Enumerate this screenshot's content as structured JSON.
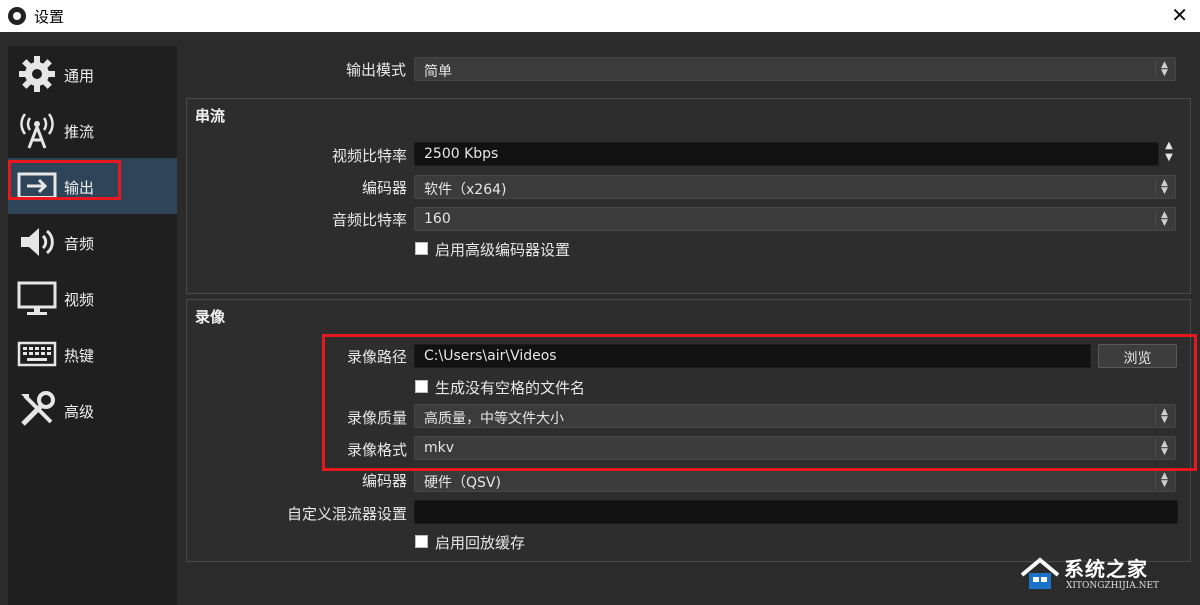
{
  "window": {
    "title": "设置",
    "close_glyph": "✕"
  },
  "sidebar": {
    "items": [
      {
        "label": "通用",
        "icon": "gear-icon"
      },
      {
        "label": "推流",
        "icon": "broadcast-antenna-icon"
      },
      {
        "label": "输出",
        "icon": "output-icon",
        "active": true
      },
      {
        "label": "音频",
        "icon": "speaker-icon"
      },
      {
        "label": "视频",
        "icon": "monitor-icon"
      },
      {
        "label": "热键",
        "icon": "keyboard-icon"
      },
      {
        "label": "高级",
        "icon": "tools-icon"
      }
    ]
  },
  "output_mode": {
    "label": "输出模式",
    "value": "简单"
  },
  "streaming": {
    "title": "串流",
    "video_bitrate": {
      "label": "视频比特率",
      "value": "2500 Kbps"
    },
    "encoder": {
      "label": "编码器",
      "value": "软件（x264)"
    },
    "audio_bitrate": {
      "label": "音频比特率",
      "value": "160"
    },
    "advanced_encoder": {
      "label": "启用高级编码器设置",
      "checked": false
    }
  },
  "recording": {
    "title": "录像",
    "path": {
      "label": "录像路径",
      "value": "C:\\Users\\air\\Videos",
      "browse_label": "浏览"
    },
    "no_space_filename": {
      "label": "生成没有空格的文件名",
      "checked": false
    },
    "quality": {
      "label": "录像质量",
      "value": "高质量，中等文件大小"
    },
    "format": {
      "label": "录像格式",
      "value": "mkv"
    },
    "encoder": {
      "label": "编码器",
      "value": "硬件（QSV)"
    },
    "muxer": {
      "label": "自定义混流器设置",
      "value": ""
    },
    "replay_buffer": {
      "label": "启用回放缓存",
      "checked": false
    }
  },
  "watermark": {
    "text": "系统之家",
    "url": "XITONGZHIJIA.NET"
  },
  "colors": {
    "highlight": "#e8191e",
    "sidebar_active": "#2e4458",
    "background": "#2b2b2b"
  }
}
